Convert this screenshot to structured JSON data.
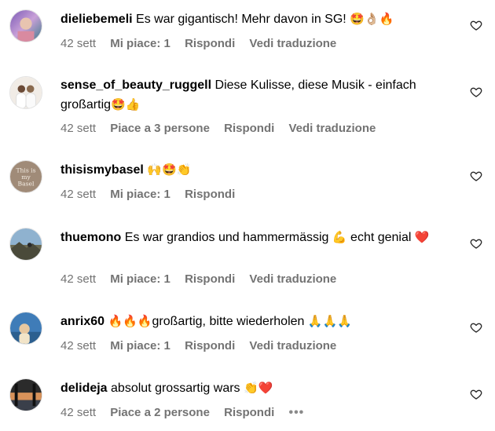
{
  "comments": [
    {
      "username": "dieliebemeli",
      "text": "Es war gigantisch! Mehr davon in SG!",
      "emoji": "🤩👌🏼🔥",
      "time": "42 sett",
      "likes": "Mi piace: 1",
      "reply": "Rispondi",
      "translate": "Vedi traduzione"
    },
    {
      "username": "sense_of_beauty_ruggell",
      "text": "Diese Kulisse, diese Musik - einfach großartig",
      "emoji": "🤩👍",
      "time": "42 sett",
      "likes": "Piace a 3 persone",
      "reply": "Rispondi",
      "translate": "Vedi traduzione"
    },
    {
      "username": "thisismybasel",
      "text": "",
      "emoji": "🙌🤩👏",
      "time": "42 sett",
      "likes": "Mi piace: 1",
      "reply": "Rispondi",
      "avatar_text": "This is my Basel"
    },
    {
      "username": "thuemono",
      "text": "Es war grandios und hammermässig",
      "emoji": "💪",
      "text2": "echt genial",
      "emoji2": "❤️",
      "time": "42 sett",
      "likes": "Mi piace: 1",
      "reply": "Rispondi",
      "translate": "Vedi traduzione"
    },
    {
      "username": "anrix60",
      "emoji_pre": "🔥🔥🔥",
      "text": "großartig, bitte wiederholen",
      "emoji": "🙏🙏🙏",
      "time": "42 sett",
      "likes": "Mi piace: 1",
      "reply": "Rispondi",
      "translate": "Vedi traduzione"
    },
    {
      "username": "delideja",
      "text": "absolut grossartig wars",
      "emoji": "👏❤️",
      "time": "42 sett",
      "likes": "Piace a 2 persone",
      "reply": "Rispondi",
      "more": "•••"
    }
  ],
  "icons": {
    "like": "heart-outline-icon",
    "more": "more-options-icon"
  },
  "colors": {
    "meta": "#737373",
    "text": "#000000"
  }
}
